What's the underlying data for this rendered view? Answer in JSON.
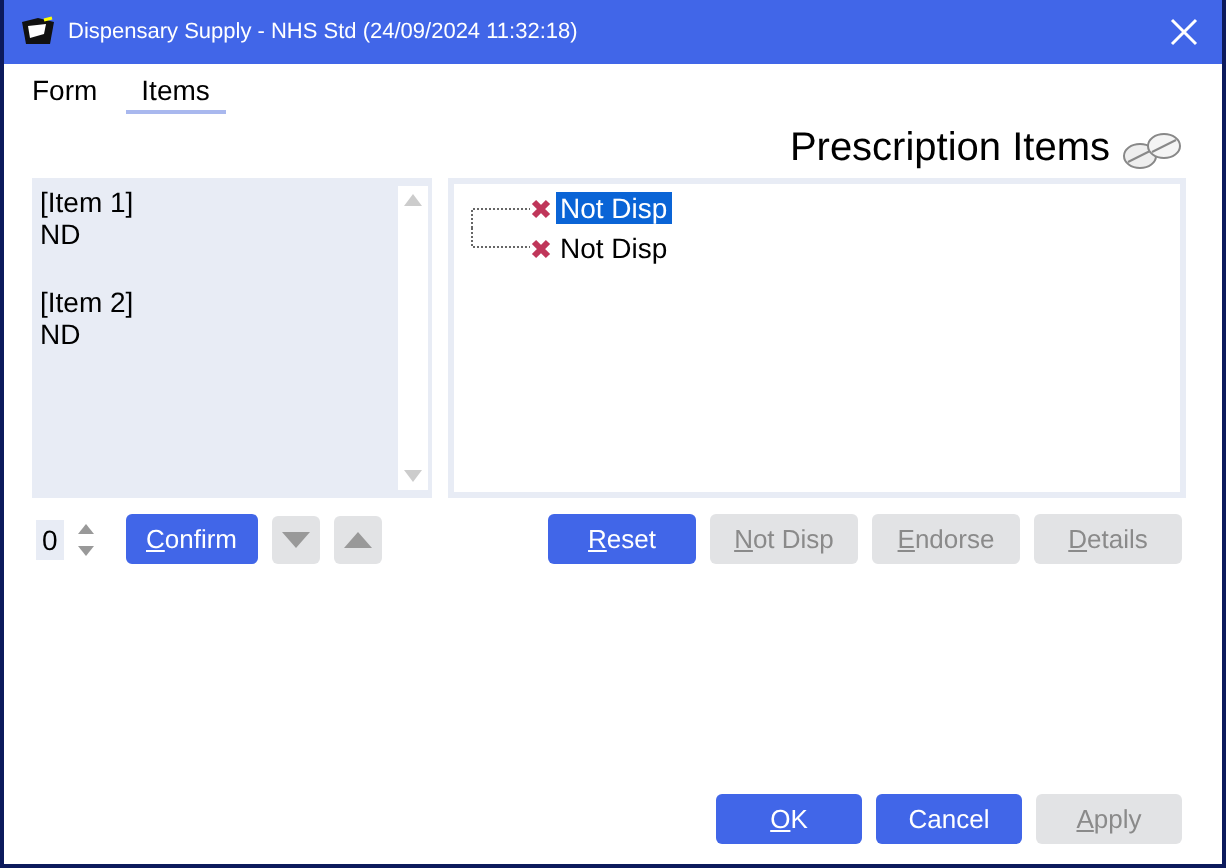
{
  "window": {
    "title": "Dispensary Supply - NHS Std (24/09/2024 11:32:18)"
  },
  "tabs": [
    {
      "label": "Form",
      "selected": false
    },
    {
      "label": "Items",
      "selected": true
    }
  ],
  "heading": "Prescription Items",
  "item_list": [
    {
      "name": "[Item 1]",
      "value": "ND"
    },
    {
      "name": "[Item 2]",
      "value": "ND"
    }
  ],
  "tree": [
    {
      "label": "Not Disp",
      "selected": true
    },
    {
      "label": "Not Disp",
      "selected": false
    }
  ],
  "quantity": "0",
  "left_buttons": [
    {
      "kind": "text",
      "label": "Confirm",
      "disabled": false,
      "mnemonic": true
    },
    {
      "kind": "down",
      "disabled": true
    },
    {
      "kind": "up",
      "disabled": true
    }
  ],
  "action_buttons": [
    {
      "label": "Reset",
      "disabled": false,
      "mnemonic": true
    },
    {
      "label": "Not Disp",
      "disabled": true,
      "mnemonic": true
    },
    {
      "label": "Endorse",
      "disabled": true,
      "mnemonic": true
    },
    {
      "label": "Details",
      "disabled": true,
      "mnemonic": true
    }
  ],
  "footer_buttons": [
    {
      "label": "OK",
      "disabled": false,
      "mnemonic": true
    },
    {
      "label": "Cancel",
      "disabled": false,
      "mnemonic": false
    },
    {
      "label": "Apply",
      "disabled": true,
      "mnemonic": true
    }
  ]
}
